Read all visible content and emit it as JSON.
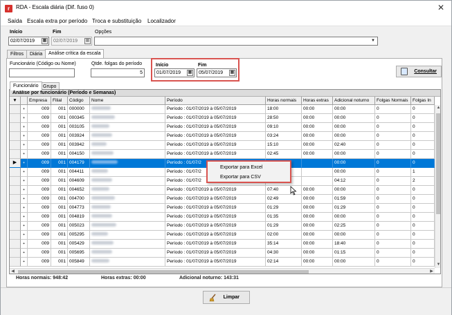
{
  "window": {
    "title": "RDA - Escala diária (Dif. fuso 0)",
    "icon": "app-logo-icon",
    "close": "✕"
  },
  "menu": [
    "Saída",
    "Escala extra por período",
    "Troca e substituição",
    "Localizador"
  ],
  "filters": {
    "inicio_label": "Início",
    "inicio_value": "02/07/2019",
    "fim_label": "Fim",
    "fim_value": "02/07/2019",
    "opcoes_label": "Opções",
    "opcoes_value": ""
  },
  "top_tabs": [
    "Filtros",
    "Diária",
    "Análise crítica da escala"
  ],
  "analysis": {
    "funcionario_label": "Funcionário (Código ou Nome)",
    "funcionario_value": "",
    "folgas_label": "Qtde. folgas do período",
    "folgas_value": "5",
    "inicio_label": "Início",
    "inicio_value": "01/07/2019",
    "fim_label": "Fim",
    "fim_value": "05/07/2019",
    "consultar_label": "Consultar"
  },
  "sub_tabs": [
    "Funcionário",
    "Grupo"
  ],
  "grid": {
    "title": "Análise por funcionário (Período e Semanas)",
    "columns": [
      "",
      "",
      "Empresa",
      "Filial",
      "Código",
      "Nome",
      "Período",
      "Horas normais",
      "Horas extras",
      "Adicional noturno",
      "Folgas Normais",
      "Folgas In"
    ],
    "rows": [
      {
        "empresa": "009",
        "filial": "001",
        "codigo": "000000",
        "periodo": "Período : 01/07/2019 à 05/07/2019",
        "horas_normais": "18:00",
        "horas_extras": "00:00",
        "adicional": "00:00",
        "folgas_normais": "0",
        "folgas_in": "0"
      },
      {
        "empresa": "009",
        "filial": "001",
        "codigo": "000345",
        "periodo": "Período : 01/07/2019 à 05/07/2019",
        "horas_normais": "28:50",
        "horas_extras": "00:00",
        "adicional": "00:00",
        "folgas_normais": "0",
        "folgas_in": "0"
      },
      {
        "empresa": "009",
        "filial": "001",
        "codigo": "003105",
        "periodo": "Período : 01/07/2019 à 05/07/2019",
        "horas_normais": "09:10",
        "horas_extras": "00:00",
        "adicional": "00:00",
        "folgas_normais": "0",
        "folgas_in": "0"
      },
      {
        "empresa": "009",
        "filial": "001",
        "codigo": "003924",
        "periodo": "Período : 01/07/2019 à 05/07/2019",
        "horas_normais": "03:24",
        "horas_extras": "00:00",
        "adicional": "00:00",
        "folgas_normais": "0",
        "folgas_in": "0"
      },
      {
        "empresa": "009",
        "filial": "001",
        "codigo": "003942",
        "periodo": "Período : 01/07/2019 à 05/07/2019",
        "horas_normais": "15:10",
        "horas_extras": "00:00",
        "adicional": "02:40",
        "folgas_normais": "0",
        "folgas_in": "0"
      },
      {
        "empresa": "009",
        "filial": "001",
        "codigo": "004150",
        "periodo": "Período : 01/07/2019 à 05/07/2019",
        "horas_normais": "02:45",
        "horas_extras": "00:00",
        "adicional": "00:00",
        "folgas_normais": "0",
        "folgas_in": "0"
      },
      {
        "empresa": "009",
        "filial": "001",
        "codigo": "004179",
        "periodo": "Período : 01/07/2",
        "horas_normais": "",
        "horas_extras": "",
        "adicional": "00:00",
        "folgas_normais": "0",
        "folgas_in": "0",
        "selected": true
      },
      {
        "empresa": "009",
        "filial": "001",
        "codigo": "004411",
        "periodo": "Período : 01/07/2",
        "horas_normais": "",
        "horas_extras": "",
        "adicional": "00:00",
        "folgas_normais": "0",
        "folgas_in": "1"
      },
      {
        "empresa": "009",
        "filial": "001",
        "codigo": "004609",
        "periodo": "Período : 01/07/2",
        "horas_normais": "",
        "horas_extras": "",
        "adicional": "04:12",
        "folgas_normais": "0",
        "folgas_in": "2"
      },
      {
        "empresa": "009",
        "filial": "001",
        "codigo": "004652",
        "periodo": "Período : 01/07/2019 à 05/07/2019",
        "horas_normais": "07:40",
        "horas_extras": "00:00",
        "adicional": "00:00",
        "folgas_normais": "0",
        "folgas_in": "0"
      },
      {
        "empresa": "009",
        "filial": "001",
        "codigo": "004700",
        "periodo": "Período : 01/07/2019 à 05/07/2019",
        "horas_normais": "02:49",
        "horas_extras": "00:00",
        "adicional": "01:59",
        "folgas_normais": "0",
        "folgas_in": "0"
      },
      {
        "empresa": "009",
        "filial": "001",
        "codigo": "004773",
        "periodo": "Período : 01/07/2019 à 05/07/2019",
        "horas_normais": "01:29",
        "horas_extras": "00:00",
        "adicional": "01:29",
        "folgas_normais": "0",
        "folgas_in": "0"
      },
      {
        "empresa": "009",
        "filial": "001",
        "codigo": "004819",
        "periodo": "Período : 01/07/2019 à 05/07/2019",
        "horas_normais": "01:35",
        "horas_extras": "00:00",
        "adicional": "00:00",
        "folgas_normais": "0",
        "folgas_in": "0"
      },
      {
        "empresa": "009",
        "filial": "001",
        "codigo": "005023",
        "periodo": "Período : 01/07/2019 à 05/07/2019",
        "horas_normais": "01:29",
        "horas_extras": "00:00",
        "adicional": "02:25",
        "folgas_normais": "0",
        "folgas_in": "0"
      },
      {
        "empresa": "009",
        "filial": "001",
        "codigo": "005295",
        "periodo": "Período : 01/07/2019 à 05/07/2019",
        "horas_normais": "02:00",
        "horas_extras": "00:00",
        "adicional": "00:00",
        "folgas_normais": "0",
        "folgas_in": "0"
      },
      {
        "empresa": "009",
        "filial": "001",
        "codigo": "005429",
        "periodo": "Período : 01/07/2019 à 05/07/2019",
        "horas_normais": "35:14",
        "horas_extras": "00:00",
        "adicional": "18:40",
        "folgas_normais": "0",
        "folgas_in": "0"
      },
      {
        "empresa": "009",
        "filial": "001",
        "codigo": "005695",
        "periodo": "Período : 01/07/2019 à 05/07/2019",
        "horas_normais": "04:30",
        "horas_extras": "00:00",
        "adicional": "01:15",
        "folgas_normais": "0",
        "folgas_in": "0"
      },
      {
        "empresa": "009",
        "filial": "001",
        "codigo": "005849",
        "periodo": "Período : 01/07/2019 à 05/07/2019",
        "horas_normais": "02:14",
        "horas_extras": "00:00",
        "adicional": "00:00",
        "folgas_normais": "0",
        "folgas_in": "0"
      }
    ]
  },
  "totals": {
    "horas_normais": "Horas normais: 948:42",
    "horas_extras": "Horas extras: 00:00",
    "adicional_noturno": "Adicional noturno: 143:31"
  },
  "context_menu": [
    "Exportar para Excel",
    "Exportar para CSV"
  ],
  "footer": {
    "limpar_label": "Limpar"
  },
  "colors": {
    "selection": "#0078d7",
    "highlight_box": "#d9534f"
  }
}
